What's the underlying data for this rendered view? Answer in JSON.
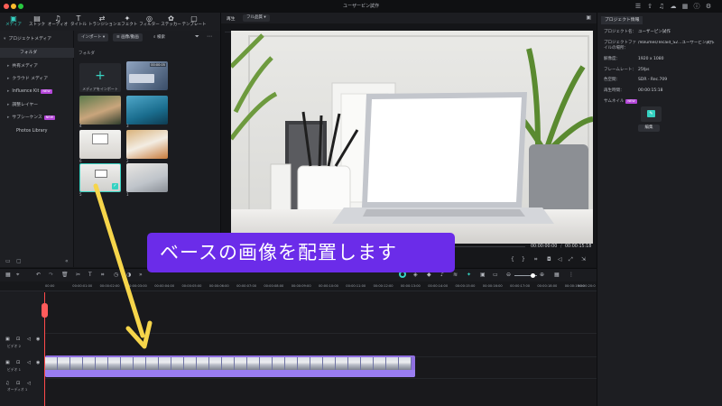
{
  "window": {
    "title": "ユーザーピン試作"
  },
  "toolbar": {
    "items": [
      {
        "label": "メディア",
        "icon": "media-icon",
        "active": true
      },
      {
        "label": "ストック",
        "icon": "stock-icon"
      },
      {
        "label": "オーディオ",
        "icon": "music-note-icon"
      },
      {
        "label": "タイトル",
        "icon": "title-icon"
      },
      {
        "label": "トランジション",
        "icon": "transition-icon"
      },
      {
        "label": "エフェクト",
        "icon": "effect-icon"
      },
      {
        "label": "フィルター",
        "icon": "filter-icon"
      },
      {
        "label": "ステッカー",
        "icon": "sticker-icon"
      },
      {
        "label": "テンプレート",
        "icon": "template-icon"
      }
    ]
  },
  "sidebar": {
    "items": [
      {
        "label": "プロジェクトメディア",
        "caret": "▾"
      },
      {
        "label": "フォルダ",
        "active": true
      },
      {
        "label": "共有メディア",
        "caret": "▸"
      },
      {
        "label": "クラウド メディア",
        "caret": "▸"
      },
      {
        "label": "Influence Kit",
        "caret": "▸",
        "badge": "NEW"
      },
      {
        "label": "調整レイヤー",
        "caret": "▸"
      },
      {
        "label": "サブシーケンス",
        "caret": "▸",
        "badge": "NEW"
      },
      {
        "label": "Photos Library"
      }
    ]
  },
  "media": {
    "import_label": "インポート",
    "sort_label": "画像/動画",
    "search_placeholder": "検索",
    "folder_label": "フォルダ",
    "import_tile_label": "メディアをインポート",
    "thumbs": [
      {
        "name": "",
        "dur": "00:00:05"
      },
      {
        "name": "4",
        "dur": ""
      },
      {
        "name": "3",
        "dur": ""
      },
      {
        "name": "6",
        "dur": ""
      },
      {
        "name": "2",
        "dur": ""
      },
      {
        "name": "5",
        "dur": ""
      },
      {
        "name": "1",
        "dur": ""
      }
    ]
  },
  "player": {
    "tab_label": "再生",
    "quality_label": "フル品質",
    "current_time": "00:00:00:00",
    "total_time": "00:00:15:18"
  },
  "inspector": {
    "tab_label": "プロジェクト情報",
    "props": [
      {
        "k": "プロジェクト名：",
        "v": "ユーザーピン試作"
      },
      {
        "k": "プロジェクトファイルの場所：",
        "v": "/Volumes/Tecaid_S2...ユーザーピン試作"
      },
      {
        "k": "解像度：",
        "v": "1920 x 1080"
      },
      {
        "k": "フレームレート：",
        "v": "25fps"
      },
      {
        "k": "色空間：",
        "v": "SDR - Rec.709"
      },
      {
        "k": "再生時間：",
        "v": "00:00:15:18"
      },
      {
        "k": "サムネイル",
        "v": "",
        "badge": "NEW"
      }
    ],
    "edit_label": "編集"
  },
  "timeline": {
    "ticks": [
      "00:00",
      "00:00:01:00",
      "00:00:02:00",
      "00:00:03:00",
      "00:00:04:00",
      "00:00:05:00",
      "00:00:06:00",
      "00:00:07:00",
      "00:00:08:00",
      "00:00:09:00",
      "00:00:10:00",
      "00:00:11:00",
      "00:00:12:00",
      "00:00:13:00",
      "00:00:14:00",
      "00:00:15:00",
      "00:00:16:00",
      "00:00:17:00",
      "00:00:18:00",
      "00:00:19:00",
      "00:00:20:0"
    ],
    "tracks": [
      {
        "label": "ビデオ 2"
      },
      {
        "label": "ビデオ 1"
      },
      {
        "label": "オーディオ 1"
      }
    ]
  },
  "caption": {
    "text": "ベースの画像を配置します"
  },
  "colors": {
    "accent": "#35d2c2",
    "caption_bg": "#6b2ce9",
    "clip": "#9a7df2",
    "arrow": "#f6d54a",
    "playhead": "#ff4a4a"
  }
}
